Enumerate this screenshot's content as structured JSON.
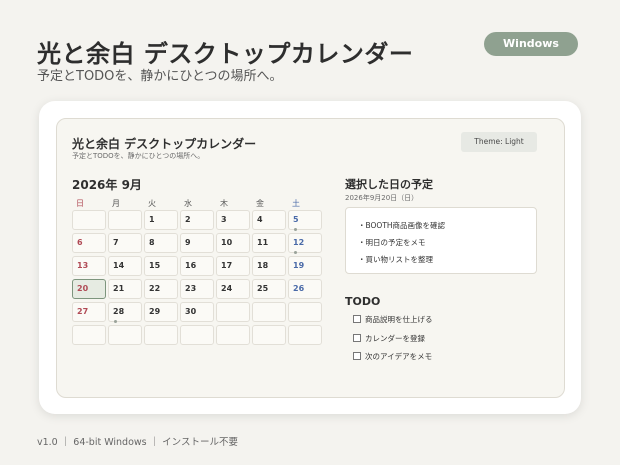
{
  "hero": {
    "title": "光と余白 デスクトップカレンダー",
    "subtitle": "予定とTODOを、静かにひとつの場所へ。",
    "platform_badge": "Windows"
  },
  "app": {
    "title": "光と余白 デスクトップカレンダー",
    "subtitle": "予定とTODOを、静かにひとつの場所へ。",
    "theme_label": "Theme: Light"
  },
  "calendar": {
    "month_label": "2026年 9月",
    "weekdays": [
      "日",
      "月",
      "火",
      "水",
      "木",
      "金",
      "土"
    ],
    "weeks": [
      [
        "",
        "",
        "1",
        "2",
        "3",
        "4",
        "5"
      ],
      [
        "6",
        "7",
        "8",
        "9",
        "10",
        "11",
        "12"
      ],
      [
        "13",
        "14",
        "15",
        "16",
        "17",
        "18",
        "19"
      ],
      [
        "20",
        "21",
        "22",
        "23",
        "24",
        "25",
        "26"
      ],
      [
        "27",
        "28",
        "29",
        "30",
        "",
        "",
        ""
      ],
      [
        "",
        "",
        "",
        "",
        "",
        "",
        ""
      ]
    ],
    "selected_day": "20",
    "days_with_events": [
      "5",
      "12",
      "28"
    ]
  },
  "selected": {
    "heading": "選択した日の予定",
    "date_label": "2026年9月20日（日）",
    "events": [
      "・BOOTH商品画像を確認",
      "・明日の予定をメモ",
      "・買い物リストを整理"
    ]
  },
  "todo": {
    "heading": "TODO",
    "items": [
      {
        "label": "商品説明を仕上げる",
        "done": false
      },
      {
        "label": "カレンダーを登録",
        "done": false
      },
      {
        "label": "次のアイデアをメモ",
        "done": false
      }
    ]
  },
  "footer": {
    "text": "v1.0 ｜ 64-bit Windows ｜ インストール不要"
  }
}
